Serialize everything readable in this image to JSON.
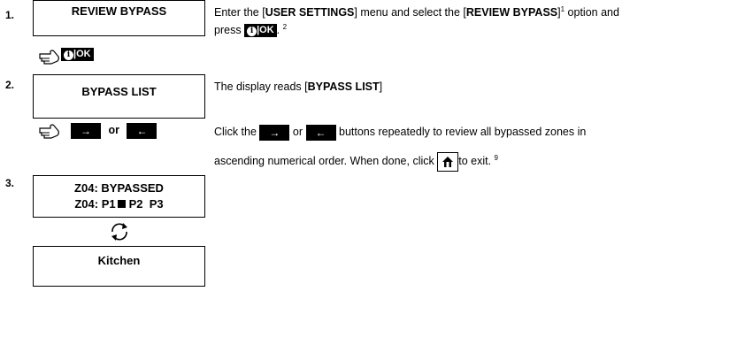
{
  "steps": [
    {
      "number": "1.",
      "display": [
        "REVIEW BYPASS"
      ],
      "desc": {
        "a": "Enter the [",
        "b": "USER SETTINGS",
        "c": "] menu and select the [",
        "d": "REVIEW BYPASS",
        "e": "]",
        "sup1": "1",
        "f": " option and",
        "g": "press",
        "h": ". ",
        "sup2": "2"
      }
    },
    {
      "number": "2.",
      "display": [
        "BYPASS LIST"
      ],
      "desc": {
        "a": "The display reads [",
        "b": "BYPASS LIST",
        "c": "]"
      },
      "nav_or": "or",
      "click": {
        "a": "Click the",
        "or": "or",
        "b": "buttons repeatedly to review all bypassed zones in",
        "c": "ascending numerical order. When done, click",
        "d": "to exit. ",
        "sup": "9"
      }
    },
    {
      "number": "3.",
      "display": [
        "Z04: BYPASSED",
        "Z04: P1",
        "P2  P3"
      ],
      "display2": [
        "Kitchen"
      ]
    }
  ],
  "keys": {
    "ok": "OK",
    "sep": "|",
    "info": "i",
    "right": "→",
    "left": "←"
  }
}
